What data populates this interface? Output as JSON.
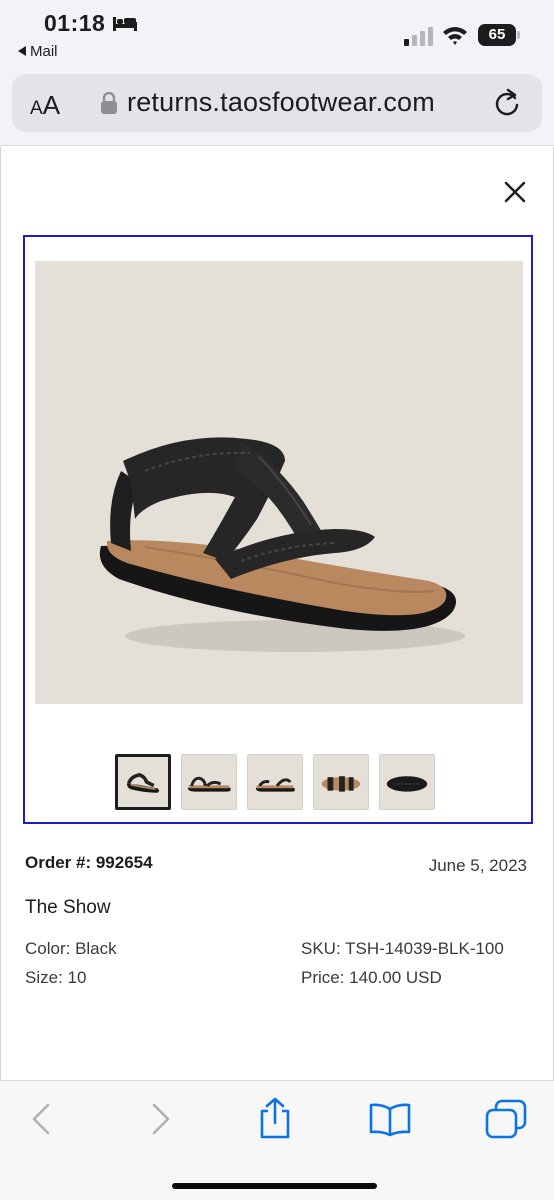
{
  "status_bar": {
    "time": "01:18",
    "back_app": "Mail",
    "battery": "65",
    "icons": [
      "bed-icon",
      "signal-icon",
      "wifi-icon",
      "battery-icon"
    ]
  },
  "browser": {
    "text_size_label_small": "A",
    "text_size_label_large": "A",
    "url": "returns.taosfootwear.com"
  },
  "product": {
    "order_number": "Order #: 992654",
    "date": "June 5, 2023",
    "name": "The Show",
    "color": "Color: Black",
    "size": "Size: 10",
    "sku": "SKU: TSH-14039-BLK-100",
    "price": "Price: 140.00 USD",
    "thumbnails": [
      "front-angle",
      "side",
      "inner-side",
      "top",
      "sole"
    ],
    "selected_thumbnail": 0
  },
  "colors": {
    "gallery_border": "#1c1cc9",
    "image_bg": "#e4e0d8",
    "ios_blue": "#0a74e6"
  }
}
